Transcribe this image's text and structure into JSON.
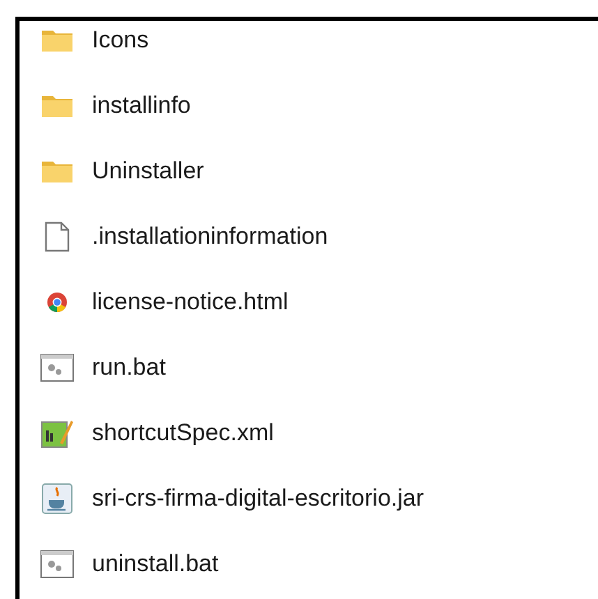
{
  "files": [
    {
      "name": "Icons",
      "kind": "folder"
    },
    {
      "name": "installinfo",
      "kind": "folder"
    },
    {
      "name": "Uninstaller",
      "kind": "folder"
    },
    {
      "name": ".installationinformation",
      "kind": "file"
    },
    {
      "name": "license-notice.html",
      "kind": "html"
    },
    {
      "name": "run.bat",
      "kind": "batch"
    },
    {
      "name": "shortcutSpec.xml",
      "kind": "xml"
    },
    {
      "name": "sri-crs-firma-digital-escritorio.jar",
      "kind": "jar"
    },
    {
      "name": "uninstall.bat",
      "kind": "batch"
    }
  ]
}
